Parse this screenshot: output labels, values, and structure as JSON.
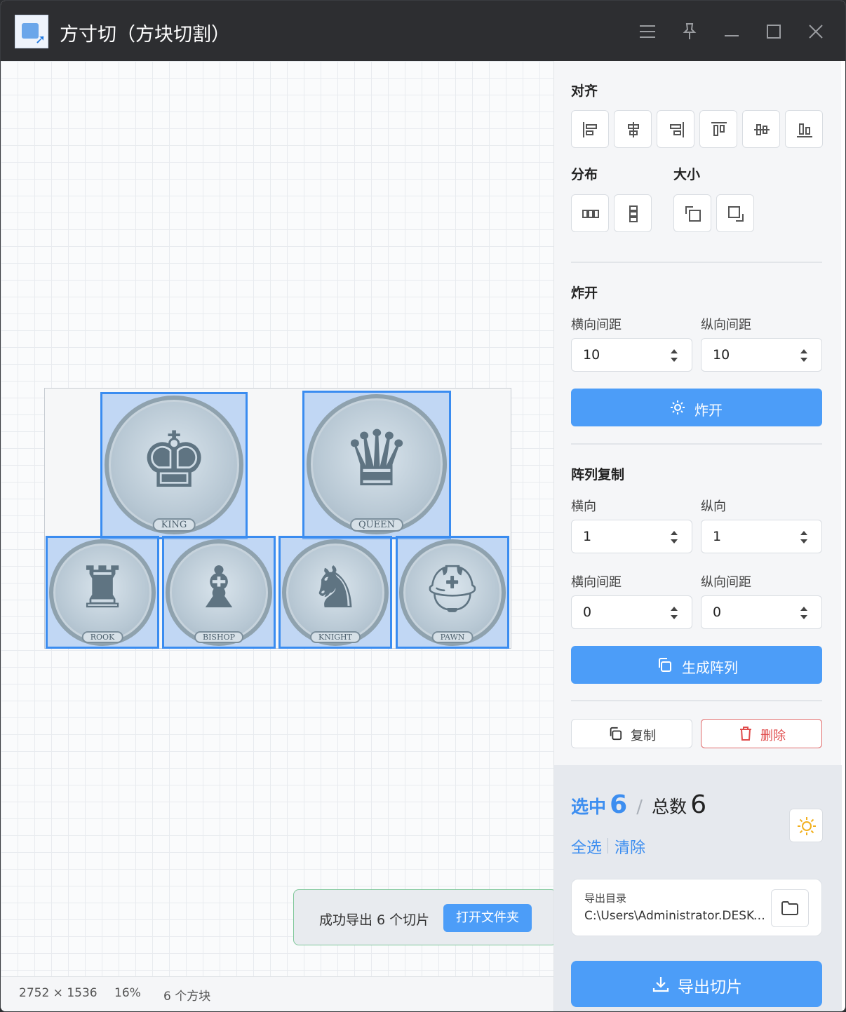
{
  "window": {
    "title": "方寸切（方块切割）"
  },
  "titlebar_controls": [
    "menu-icon",
    "pin-icon",
    "minimize-icon",
    "maximize-icon",
    "close-icon"
  ],
  "canvas": {
    "slices": [
      {
        "label": "KING",
        "glyph": "♚"
      },
      {
        "label": "QUEEN",
        "glyph": "♛"
      },
      {
        "label": "ROOK",
        "glyph": "♜"
      },
      {
        "label": "BISHOP",
        "glyph": "♝"
      },
      {
        "label": "KNIGHT",
        "glyph": "♞"
      },
      {
        "label": "PAWN",
        "glyph": "⛑"
      }
    ]
  },
  "status": {
    "dimensions": "2752 × 1536",
    "zoom": "16%",
    "block_count": "6 个方块"
  },
  "toast": {
    "message": "成功导出 6 个切片",
    "button": "打开文件夹",
    "border_color": "#7fc79a"
  },
  "panel": {
    "align": {
      "title": "对齐",
      "buttons": [
        "align-left-icon",
        "align-center-h-icon",
        "align-right-icon",
        "align-top-icon",
        "align-middle-v-icon",
        "align-bottom-icon"
      ]
    },
    "distribute": {
      "title": "分布",
      "buttons": [
        "distribute-horizontal-icon",
        "distribute-vertical-icon"
      ]
    },
    "size": {
      "title": "大小",
      "buttons": [
        "size-min-icon",
        "size-max-icon"
      ]
    },
    "explode": {
      "title": "炸开",
      "h_gap_label": "横向间距",
      "h_gap_value": "10",
      "v_gap_label": "纵向间距",
      "v_gap_value": "10",
      "button": "炸开"
    },
    "array": {
      "title": "阵列复制",
      "h_label": "横向",
      "h_value": "1",
      "v_label": "纵向",
      "v_value": "1",
      "h_gap_label": "横向间距",
      "h_gap_value": "0",
      "v_gap_label": "纵向间距",
      "v_gap_value": "0",
      "button": "生成阵列"
    },
    "copy_button": "复制",
    "delete_button": "删除",
    "selection": {
      "selected_label": "选中",
      "selected_count": "6",
      "separator": "/",
      "total_label": "总数",
      "total_count": "6"
    },
    "select_all": "全选",
    "clear": "清除",
    "export_dir": {
      "label": "导出目录",
      "path": "C:\\Users\\Administrator.DESKTOP"
    },
    "export_button": "导出切片"
  },
  "colors": {
    "accent": "#4c9df8",
    "danger": "#e04b4b",
    "selection": "#3a8cf0"
  }
}
